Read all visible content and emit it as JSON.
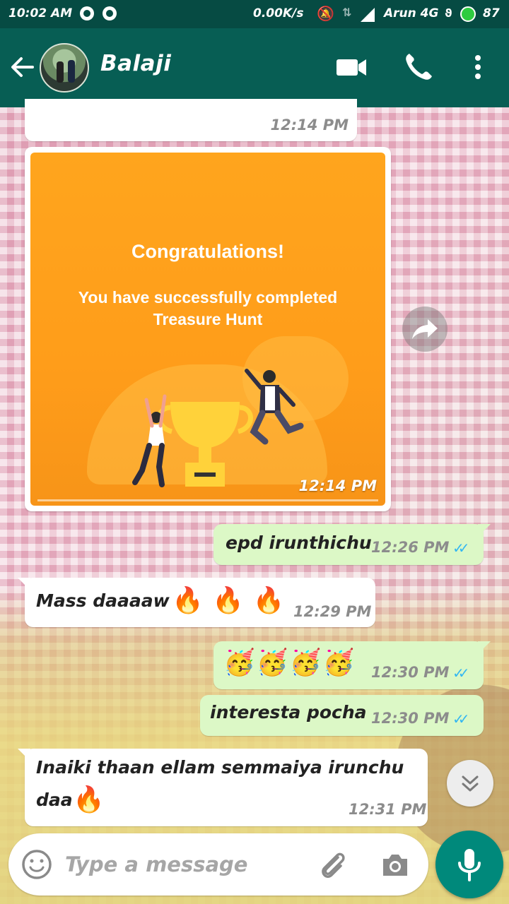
{
  "status_bar": {
    "time": "10:02 AM",
    "network_speed": "0.00K/s",
    "carrier": "Arun 4G",
    "battery": "87",
    "icons": [
      "whatsapp-icon",
      "whatsapp-icon",
      "mute-icon",
      "data-arrows-icon",
      "signal-icon",
      "charging-icon",
      "status-dot-icon"
    ]
  },
  "header": {
    "contact_name": "Balaji",
    "icons": [
      "back-arrow-icon",
      "avatar",
      "video-call-icon",
      "phone-icon",
      "more-vert-icon"
    ]
  },
  "messages": [
    {
      "direction": "in",
      "text": "",
      "time": "12:14 PM"
    },
    {
      "direction": "in",
      "type": "image",
      "image": {
        "title": "Congratulations!",
        "subtitle": "You have successfully completed Treasure Hunt",
        "icons": [
          "trophy-icon",
          "celebrating-people-icon"
        ]
      },
      "time": "12:14 PM"
    },
    {
      "direction": "out",
      "text": "epd irunthichu",
      "time": "12:26 PM",
      "status": "read"
    },
    {
      "direction": "in",
      "text": "Mass daaaaw",
      "emoji": "🔥 🔥 🔥",
      "time": "12:29 PM"
    },
    {
      "direction": "out",
      "text": "",
      "emoji": "🥳🥳🥳🥳",
      "time": "12:30 PM",
      "status": "read"
    },
    {
      "direction": "out",
      "text": "interesta pocha",
      "time": "12:30 PM",
      "status": "read"
    },
    {
      "direction": "in",
      "text": "Inaiki thaan ellam semmaiya irunchu",
      "text2": "daa",
      "emoji": "🔥",
      "time": "12:31 PM"
    }
  ],
  "composer": {
    "placeholder": "Type a message",
    "icons": [
      "emoji-icon",
      "attach-icon",
      "camera-icon",
      "mic-icon"
    ]
  },
  "colors": {
    "status_bar": "#064b43",
    "app_bar": "#075e54",
    "outgoing_bubble": "#dcf8c6",
    "incoming_bubble": "#ffffff",
    "read_ticks": "#34b7f1",
    "mic_button": "#00897b",
    "image_bg": "#ffa51d"
  }
}
